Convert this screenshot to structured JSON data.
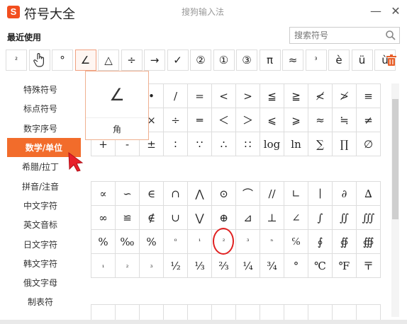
{
  "window": {
    "logo_text": "S",
    "title": "符号大全",
    "center_title": "搜狗输入法",
    "minimize_icon": "minimize-icon",
    "close_icon": "close-icon"
  },
  "recent": {
    "label": "最近使用",
    "items": [
      "²",
      "",
      "°",
      "∠",
      "△",
      "÷",
      "→",
      "✓",
      "②",
      "①",
      "③",
      "π",
      "≈",
      "³",
      "è",
      "ü",
      "ù"
    ],
    "selected_index": 3,
    "trash_icon": "trash-icon"
  },
  "search": {
    "placeholder": "搜索符号",
    "icon": "search-icon"
  },
  "popup": {
    "symbol": "∠",
    "name": "角"
  },
  "sidebar": {
    "items": [
      "特殊符号",
      "标点符号",
      "数字序号",
      "数学/单位",
      "希腊/拉丁",
      "拼音/注音",
      "中文字符",
      "英文音标",
      "日文字符",
      "韩文字符",
      "俄文字母",
      "制表符"
    ],
    "active_index": 3
  },
  "grid1": [
    [
      "",
      "",
      "•",
      "/",
      "=",
      "<",
      ">",
      "≦",
      "≧",
      "≮",
      "≯",
      "≡"
    ],
    [
      "",
      "",
      "×",
      "÷",
      "═",
      "＜",
      "＞",
      "⩽",
      "⩾",
      "≈",
      "≒",
      "≠"
    ],
    [
      "+",
      "-",
      "±",
      "∶",
      "∵",
      "∴",
      "∷",
      "log",
      "ln",
      "∑",
      "∏",
      "∅"
    ]
  ],
  "grid2": [
    [
      "∝",
      "∽",
      "∈",
      "∩",
      "⋀",
      "⊙",
      "⌒",
      "//",
      "∟",
      "∣",
      "∂",
      "∆"
    ],
    [
      "∞",
      "≌",
      "∉",
      "∪",
      "⋁",
      "⊕",
      "⊿",
      "⊥",
      "∠",
      "∫",
      "∬",
      "∭"
    ],
    [
      "%",
      "‰",
      "%",
      "⁰",
      "¹",
      "²",
      "³",
      "ⁿ",
      "℅",
      "∮",
      "∯",
      "∰"
    ],
    [
      "₁",
      "₂",
      "₃",
      "½",
      "⅓",
      "⅔",
      "¼",
      "¾",
      "°",
      "℃",
      "℉",
      "〒"
    ]
  ],
  "grid3": [
    [
      "",
      "",
      "",
      "",
      "",
      "",
      "",
      "",
      "",
      "",
      "",
      ""
    ]
  ],
  "colors": {
    "accent": "#f26c2b",
    "highlight_circle": "#e02020",
    "selected_border": "#f0a080"
  }
}
